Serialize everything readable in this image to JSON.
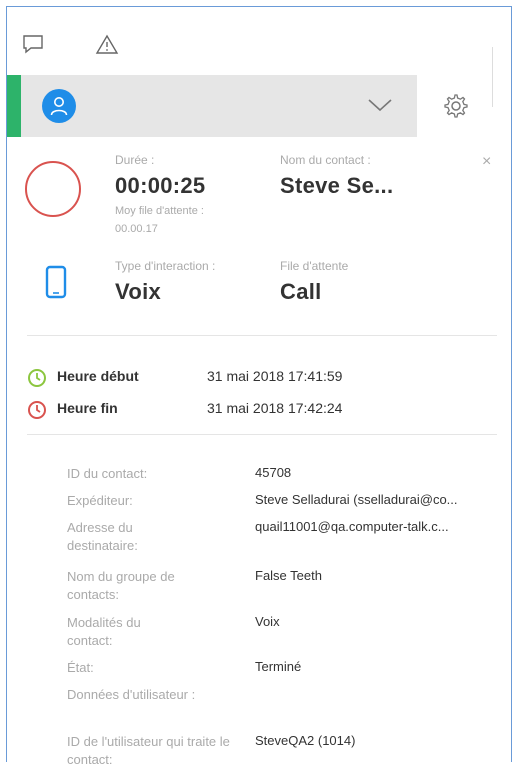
{
  "toolbar": {
    "chat_icon": "chat-bubble-icon",
    "warning_icon": "warning-triangle-icon"
  },
  "header": {
    "accent_color": "#2db36a",
    "avatar_icon": "user-avatar-icon",
    "avatar_color": "#1f8de8",
    "dropdown_icon": "chevron-down-icon",
    "settings_icon": "gear-icon"
  },
  "summary": {
    "duration_label": "Durée :",
    "duration_value": "00:00:25",
    "avg_queue_label": "Moy file d'attente :",
    "avg_queue_value": "00.00.17",
    "contact_name_label": "Nom du contact :",
    "contact_name_value": "Steve Se...",
    "interaction_type_label": "Type d'interaction :",
    "interaction_type_value": "Voix",
    "queue_label": "File d'attente",
    "queue_value": "Call",
    "close_symbol": "×"
  },
  "times": {
    "start_label": "Heure début",
    "start_value": "31 mai 2018 17:41:59",
    "end_label": "Heure fin",
    "end_value": "31 mai 2018 17:42:24",
    "start_color": "#8cc63f",
    "end_color": "#d9534f"
  },
  "details": [
    {
      "key": "ID du contact:",
      "value": "45708"
    },
    {
      "key": "Expéditeur:",
      "value": "Steve Selladurai (sselladurai@co..."
    },
    {
      "key": "Adresse du destinataire:",
      "value": "quail11001@qa.computer-talk.c..."
    },
    {
      "key": "Nom du groupe de contacts:",
      "value": "False Teeth"
    },
    {
      "key": "Modalités du contact:",
      "value": "Voix"
    },
    {
      "key": "État:",
      "value": "Terminé"
    },
    {
      "key": "Données d'utilisateur :",
      "value": ""
    },
    {
      "key": "ID de l'utilisateur qui traite le contact:",
      "value": "SteveQA2 (1014)"
    }
  ]
}
